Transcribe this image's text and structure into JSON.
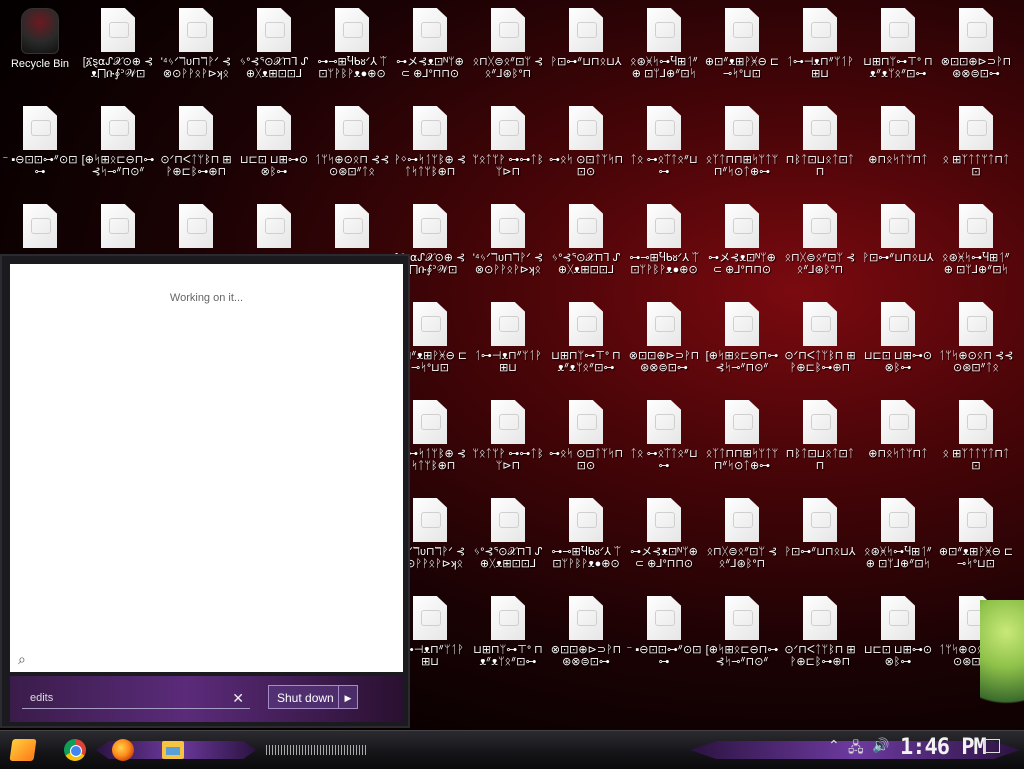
{
  "desktop": {
    "recycle_bin_label": "Recycle Bin",
    "files": [
      "[፩ȿ⍺ᔑ𝒳⊙⊕ ⊰ᴥ⨅ቡ⨕ᐣ𝒲⊡",
      "'⁴ᛃᐟℸυ⊓ℸᚹᐟ ⊰⊗⊙ᚹᚹᛟᚹ⊳ʞᛟ",
      "ᛃᐤ⊰ᕐ⊙𝒳⊓⅂ ᔑ⊕ᚷᴥ⊞⊡⊡⅃",
      "⊶⊸⊞Ⴏᑲᴕᐟ⅄ ᛠ⊡ᛘᚹᛒᚹᴥ●⊕⊙",
      "⊶メ⊰ᴥ⊡ᴺᛘ⊕⊂ ⊕⅃ᐤ⊓⊓⊙",
      "ᛟ⊓ᚷ⊜ᛟᐥ⊡ᛘ ⊰ᛟᐥ⅃⊛ᛒᐤ⊓",
      "ᚹ⊡⊶ᐥ⊔⊓ᛟ⊔⅄",
      "ᛟ⊛ᚸᛋ⊶Ⴏ⊞ᛐᐥ⊕ ⊡ᛘ⅃⊕ᐥ⊡ᛋ",
      "⊕⊡ᐥᴥ⊞ᚹᚸ⊖ ⊏⊸ᛋᐤ⊔⊡",
      "ᛐ⊶⊣ᴥ⊓ᐥᛘᛐᚹ⊞⊔",
      "⊔⊞⊓ᛘ⊶⊤ᐤ ⊓ᴥᐥᴥᛘᛟᐥ⊡⊶",
      "⊗⊡⊡⊕⊳⊃ᚹ⊓ ⊛⊗⊜⊡⊶",
      "⁻ ▪⊖⊡⊡⊶ᐥ⊙⊡⊶",
      "[⊕ᛋ⊞ᛟ⊏⊖⊓⊶ ⊰ᛋ⊸ᐥ⊓⊙ᐥ",
      "⊙ᐟ⊓ᐸᛏᛘᛒ⊓ ⊞ᚹ⊕⊏ᛒ⊶⊕⊓",
      "⊔⊏⊡ ⊔⊞⊶⊙⊗ᛒ⊶",
      "ᛐᛘᛋ⊕⊙ᛟ⊓ ⊰⊰⊙⊛⊡ᐥᛏᛟ",
      "ᚹᛜ⊶ᛋᛐᛘᛒ⊕ ⊰ᛏᛋᛏᛘᛒ⊕⊓",
      "ᛘᛟᛏᛘᚹ ⊶⊶ᛏᛒᛘ⊳⊓",
      "⊶ᛟᛋ ⊙⊡ᛏᛉᛋ⊓⊡⊙",
      "ᛏᛟ ⊶ᛟᛠᛏᛟᐥ⊔⊶",
      "ᛟᛉᛏ⊓⊓⊞ᛋᛘᛏᛘ ⊓ᐥᛋ⊙ᛏ⊕⊶",
      "⊓ᛒᛏ⊡⊔ᛟᛏ⊡ᛏ⊓ ",
      "⊕⊓ᛟᛋᛏᛘ⊓ᛏ ",
      "ᛟ ⊞ᛉᛏᛏᛘᛏ⊓ᛏ⊡"
    ]
  },
  "start_menu": {
    "status_text": "Working on it...",
    "search_value": "edits",
    "clear_glyph": "✕",
    "shutdown_label": "Shut down"
  },
  "taskbar": {
    "apps": [
      "Start",
      "Google Chrome",
      "Firefox",
      "File Explorer"
    ],
    "clock": "1:46 PM"
  },
  "colors": {
    "accent": "#6d3aa0",
    "wallpaper": "#7a0a10"
  }
}
